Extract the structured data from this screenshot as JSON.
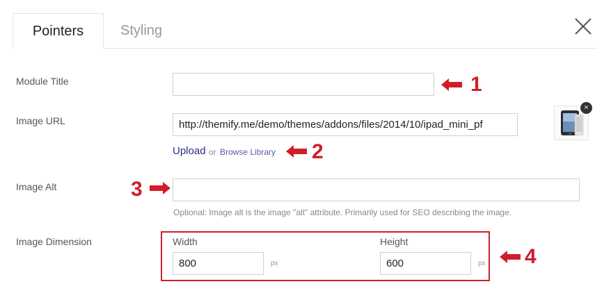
{
  "tabs": [
    {
      "label": "Pointers",
      "active": true
    },
    {
      "label": "Styling",
      "active": false
    }
  ],
  "form": {
    "module_title": {
      "label": "Module Title",
      "value": ""
    },
    "image_url": {
      "label": "Image URL",
      "value": "http://themify.me/demo/themes/addons/files/2014/10/ipad_mini_pf",
      "upload_label": "Upload",
      "or_text": "or",
      "browse_label": "Browse Library",
      "remove_glyph": "×"
    },
    "image_alt": {
      "label": "Image Alt",
      "value": "",
      "help": "Optional: Image alt is the image \"alt\" attribute. Primarily used for SEO describing the image."
    },
    "image_dimension": {
      "label": "Image Dimension",
      "width_label": "Width",
      "width_value": "800",
      "height_label": "Height",
      "height_value": "600",
      "unit": "px"
    }
  },
  "annotations": [
    {
      "number": "1",
      "icon": "arrow-left-icon"
    },
    {
      "number": "2",
      "icon": "arrow-left-icon"
    },
    {
      "number": "3",
      "icon": "arrow-right-icon"
    },
    {
      "number": "4",
      "icon": "arrow-left-icon"
    }
  ],
  "colors": {
    "annotation": "#d11d2a",
    "link": "#2a2a8c"
  }
}
